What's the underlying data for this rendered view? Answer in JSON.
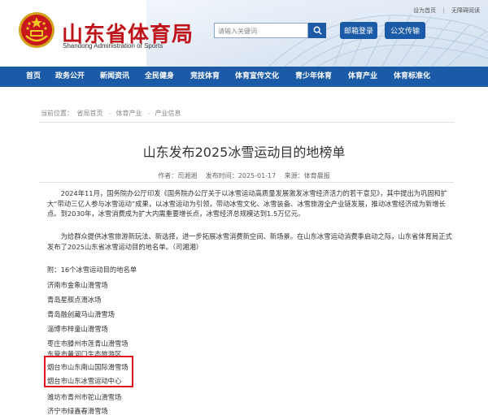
{
  "toplinks": {
    "home": "设为首页",
    "sep": "|",
    "accessible": "无障碍阅读"
  },
  "site": {
    "title": "山东省体育局",
    "subtitle": "Shandong Administration of Sports"
  },
  "search": {
    "placeholder": "请输入关键词"
  },
  "buttons": {
    "mail": "邮箱登录",
    "gov": "公文传输"
  },
  "nav": [
    "首页",
    "政务公开",
    "新闻资讯",
    "全民健身",
    "竞技体育",
    "体育宣传文化",
    "青少年体育",
    "体育产业",
    "体育标准化"
  ],
  "breadcrumb": {
    "label": "当前位置：",
    "items": [
      "省局首页",
      "体育产业",
      "产业信息"
    ],
    "sep": "-"
  },
  "article": {
    "title": "山东发布2025冰雪运动目的地榜单",
    "author": "作者：司湘湘",
    "date": "发布时间：2025-01-17",
    "source": "来源：体育晨报",
    "p1": "2024年11月，国务院办公厅印发《国务院办公厅关于以冰雪运动高质量发展激发冰雪经济活力的若干意见》，其中提出为巩固和扩大“带动三亿人参与冰雪运动”成果，以冰雪运动为引领，带动冰雪文化、冰雪装备、冰雪旅游全产业链发展，推动冰雪经济成为新增长点。到2030年，冰雪消费成为扩大内需重要增长点，冰雪经济总规模达到1.5万亿元。",
    "p2": "为给群众提供冰雪旅游新玩法、新选择，进一步拓展冰雪消费新空间、新场景。在山东冰雪运动消费季启动之际，山东省体育局正式发布了2025山东省冰雪运动目的地名单。（司湘湘）",
    "list_title": "附：16个冰雪运动目的地名单",
    "list": [
      "济南市金象山滑雪场",
      "青岛星舰点滑冰场",
      "青岛融创藏马山滑雪场",
      "淄博市梓童山滑雪场",
      "枣庄市滕州市莲青山滑雪场",
      "东营市黄河口生态旅游区",
      "烟台市山东南山国际滑雪场",
      "烟台市山东冰雪运动中心",
      "潍坊市青州市驼山滑雪场",
      "济宁市绿鑫春滑雪场"
    ]
  }
}
